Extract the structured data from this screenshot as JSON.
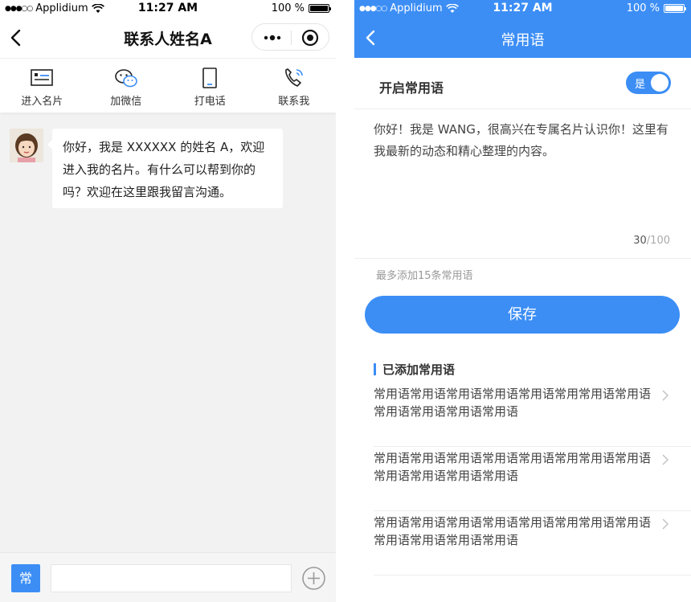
{
  "left": {
    "status": {
      "carrier": "Applidium",
      "time": "11:27 AM",
      "battery": "100 %"
    },
    "nav": {
      "title": "联系人姓名A"
    },
    "actions": [
      {
        "label": "进入名片",
        "icon": "business-card-icon"
      },
      {
        "label": "加微信",
        "icon": "wechat-icon"
      },
      {
        "label": "打电话",
        "icon": "phone-icon"
      },
      {
        "label": "联系我",
        "icon": "call-ringing-icon"
      }
    ],
    "message": {
      "text": "你好，我是 XXXXXX 的姓名 A，欢迎进入我的名片。有什么可以帮到你的吗？欢迎在这里跟我留言沟通。"
    },
    "input": {
      "quick_button": "常",
      "placeholder": ""
    }
  },
  "right": {
    "status": {
      "carrier": "Applidium",
      "time": "11:27 AM",
      "battery": "100 %"
    },
    "nav": {
      "title": "常用语"
    },
    "toggle": {
      "label": "开启常用语",
      "state_text": "是"
    },
    "textarea": {
      "text": "你好！我是 WANG，很高兴在专属名片认识你！这里有我最新的动态和精心整理的内容。",
      "count": "30",
      "max": "/100"
    },
    "hint": "最多添加15条常用语",
    "save_label": "保存",
    "section_title": "已添加常用语",
    "phrases": [
      "常用语常用语常用语常用语常用语常用常用语常用语常用语常用语常用语常用语",
      "常用语常用语常用语常用语常用语常用常用语常用语常用语常用语常用语常用语",
      "常用语常用语常用语常用语常用语常用常用语常用语常用语常用语常用语常用语"
    ]
  },
  "colors": {
    "accent": "#3c8ef5",
    "background": "#f2f2f2"
  }
}
